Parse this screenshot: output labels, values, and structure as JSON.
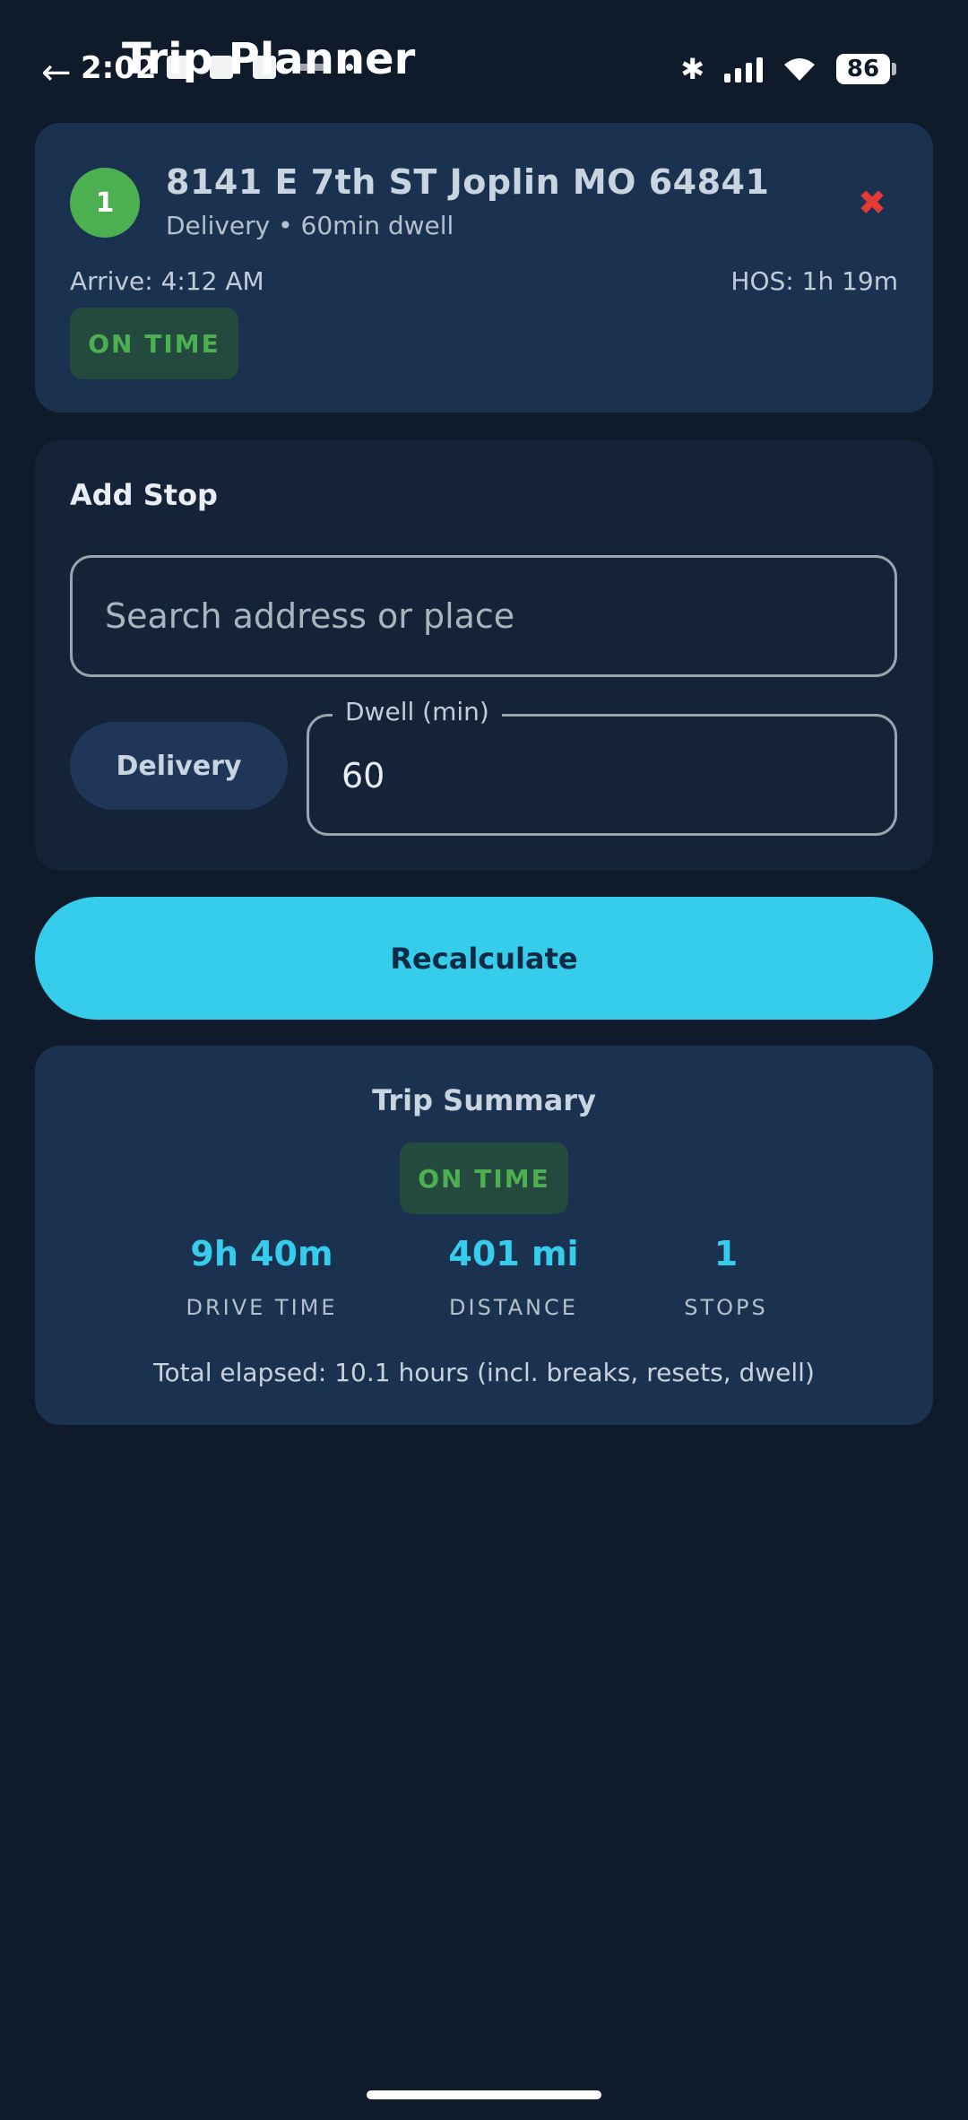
{
  "status_bar": {
    "time": "2:02",
    "battery": "86"
  },
  "header": {
    "back_icon": "arrow-left-icon",
    "title": "Trip Planner"
  },
  "stop": {
    "number": "1",
    "address": "8141 E 7th ST Joplin MO 64841",
    "subtitle": "Delivery • 60min dwell",
    "arrive": "Arrive: 4:12 AM",
    "hos": "HOS: 1h 19m",
    "status": "ON TIME",
    "remove_icon": "close-x-icon"
  },
  "add_stop": {
    "title": "Add Stop",
    "search_placeholder": "Search address or place",
    "type_label": "Delivery",
    "dwell_label": "Dwell (min)",
    "dwell_value": "60"
  },
  "actions": {
    "recalculate": "Recalculate"
  },
  "summary": {
    "title": "Trip Summary",
    "status": "ON TIME",
    "drive_time_value": "9h 40m",
    "drive_time_label": "DRIVE TIME",
    "distance_value": "401 mi",
    "distance_label": "DISTANCE",
    "stops_value": "1",
    "stops_label": "STOPS",
    "elapsed": "Total elapsed: 10.1 hours (incl. breaks, resets, dwell)"
  },
  "colors": {
    "background": "#0f1a2a",
    "card": "#1b3150",
    "accent": "#36cdec",
    "success": "#4caf50",
    "danger": "#e53935"
  }
}
